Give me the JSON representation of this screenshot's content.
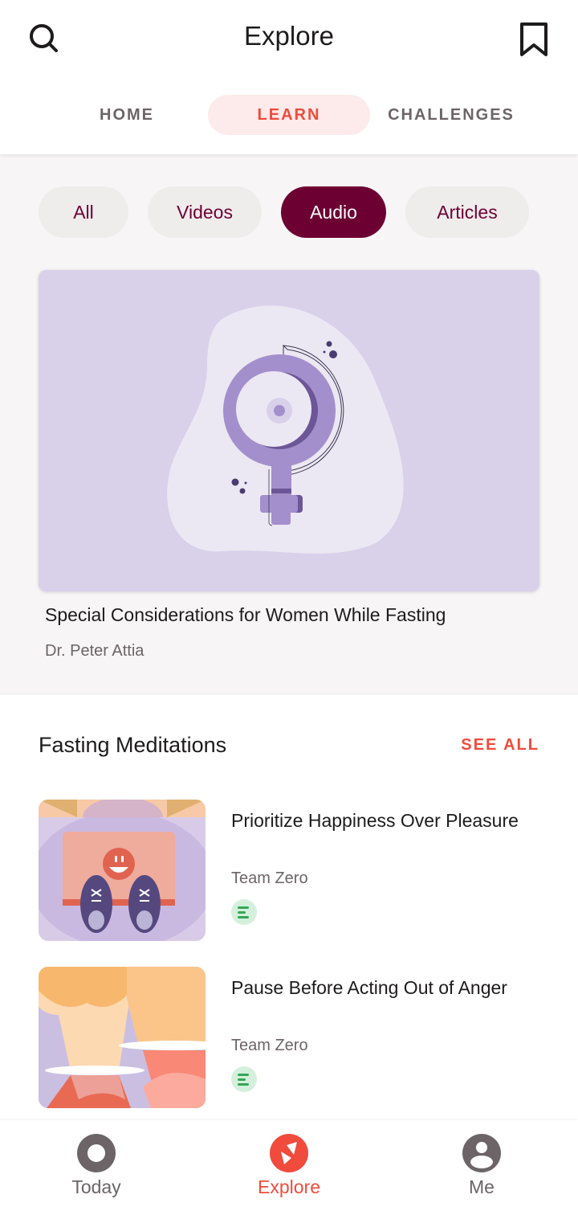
{
  "header": {
    "title": "Explore",
    "left_icon": "search-icon",
    "right_icon": "bookmark-icon"
  },
  "tabs": [
    {
      "label": "HOME",
      "active": false
    },
    {
      "label": "LEARN",
      "active": true
    },
    {
      "label": "CHALLENGES",
      "active": false
    }
  ],
  "filters": [
    {
      "label": "All",
      "active": false
    },
    {
      "label": "Videos",
      "active": false
    },
    {
      "label": "Audio",
      "active": true
    },
    {
      "label": "Articles",
      "active": false
    }
  ],
  "featured": {
    "title": "Special Considerations for Women While Fasting",
    "author": "Dr. Peter Attia",
    "image": "female-symbol-illustration"
  },
  "section": {
    "title": "Fasting Meditations",
    "see_all": "SEE ALL",
    "items": [
      {
        "title": "Prioritize Happiness Over Pleasure",
        "author": "Team Zero",
        "badge_icon": "audio-lines-icon",
        "image": "sneakers-on-mat-illustration"
      },
      {
        "title": "Pause Before Acting Out of Anger",
        "author": "Team Zero",
        "badge_icon": "audio-lines-icon",
        "image": "erupting-volcanoes-illustration"
      }
    ]
  },
  "bottom_nav": [
    {
      "label": "Today",
      "icon": "ring-icon",
      "active": false
    },
    {
      "label": "Explore",
      "icon": "compass-icon",
      "active": true
    },
    {
      "label": "Me",
      "icon": "profile-icon",
      "active": false
    }
  ],
  "colors": {
    "accent": "#f04b3c",
    "brand": "#6d0033",
    "tab_active_bg": "#fdeaea",
    "text_primary": "#1d1b1c",
    "text_secondary": "#6c6466",
    "badge_bg": "#d4f0dc",
    "badge_fg": "#34a853"
  }
}
